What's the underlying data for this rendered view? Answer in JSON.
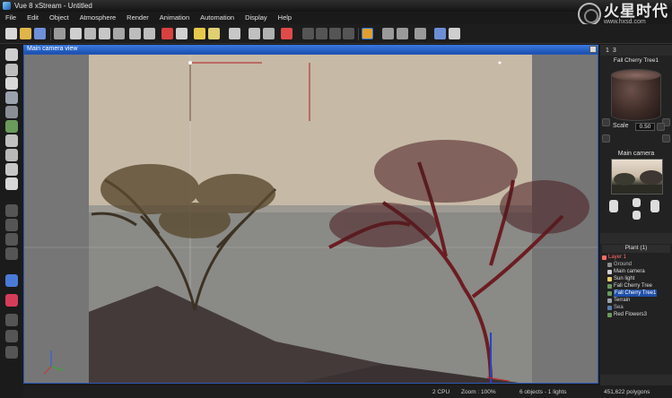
{
  "window": {
    "title": "Vue 8 xStream - Untitled"
  },
  "brand": {
    "name": "火星时代",
    "url": "www.hxsd.com"
  },
  "menu": [
    "File",
    "Edit",
    "Object",
    "Atmosphere",
    "Render",
    "Animation",
    "Automation",
    "Display",
    "Help"
  ],
  "viewport": {
    "title": "Main camera view"
  },
  "status": {
    "cpu": "2 CPU",
    "zoom": "Zoom : 100%",
    "objects": "6 objects - 1 lights",
    "polygons": "451,622 polygons"
  },
  "right_panel": {
    "tabs": [
      "1",
      "3"
    ],
    "material_name": "Fall Cherry Tree1",
    "scale_label": "Scale",
    "scale_value": "0.50",
    "camera_label": "Main camera",
    "scene_header": "Plant (1)",
    "tree": [
      {
        "label": "Layer 1",
        "type": "layer"
      },
      {
        "label": "Ground",
        "type": "ground"
      },
      {
        "label": "Main camera",
        "type": "camera"
      },
      {
        "label": "Sun light",
        "type": "light"
      },
      {
        "label": "Fall Cherry Tree",
        "type": "plant"
      },
      {
        "label": "Fall Cherry Tree1",
        "type": "plant",
        "selected": true
      },
      {
        "label": "Terrain",
        "type": "terrain"
      },
      {
        "label": "Sea",
        "type": "sea"
      },
      {
        "label": "Red Flowers3",
        "type": "plant"
      }
    ]
  },
  "colors": {
    "accent": "#2a62d0",
    "sky": "#c8bba8",
    "tree_red": "#6b1d22",
    "tree_dark": "#3c3224",
    "layer_red": "#ff6a6a"
  }
}
